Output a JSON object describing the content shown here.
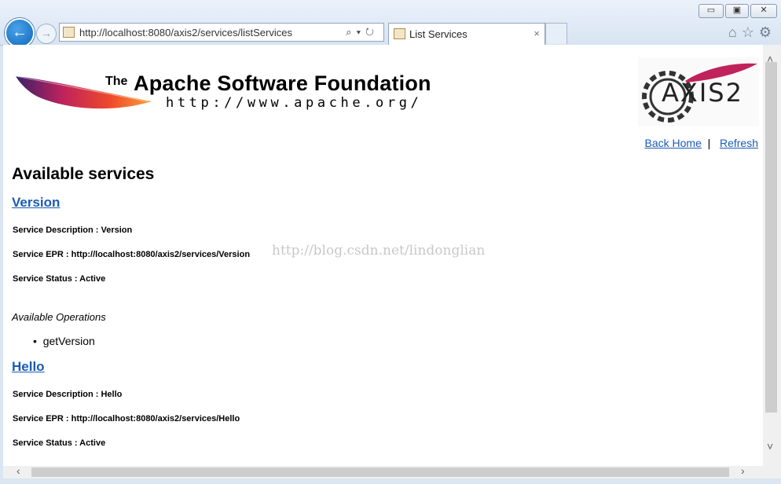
{
  "browser": {
    "address_url": "http://localhost:8080/axis2/services/listServices",
    "tab_title": "List Services",
    "tab_close": "×",
    "window_buttons": [
      "▭",
      "▣",
      "✕"
    ]
  },
  "page": {
    "asf_the": "The",
    "asf_name": "Apache Software Foundation",
    "asf_url": "http://www.apache.org/",
    "axis_logo_text": "AXIS2",
    "links": {
      "back_home": "Back Home",
      "separator": "|",
      "refresh": "Refresh"
    },
    "heading": "Available services",
    "watermark": "http://blog.csdn.net/lindonglian",
    "services": [
      {
        "name": "Version",
        "description": "Service Description : Version",
        "epr": "Service EPR : http://localhost:8080/axis2/services/Version",
        "status": "Service Status : Active",
        "operations_label": "Available Operations",
        "operations": [
          "getVersion"
        ]
      },
      {
        "name": "Hello",
        "description": "Service Description : Hello",
        "epr": "Service EPR : http://localhost:8080/axis2/services/Hello",
        "status": "Service Status : Active"
      }
    ]
  }
}
